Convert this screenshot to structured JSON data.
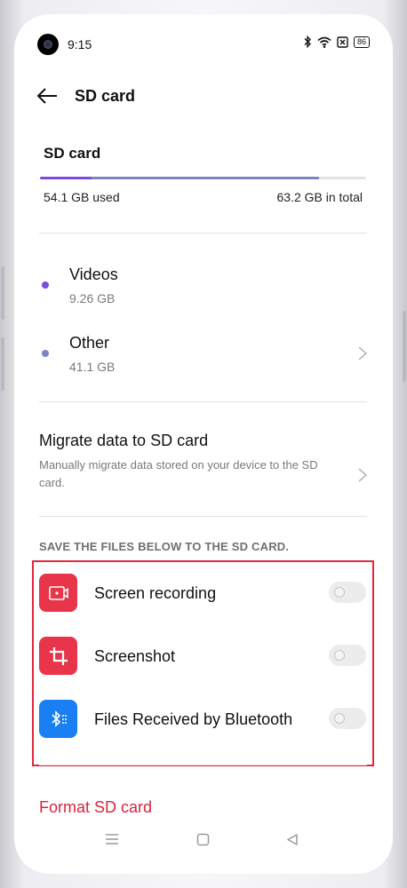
{
  "status_bar": {
    "time": "9:15",
    "battery": "86"
  },
  "header": {
    "title": "SD card"
  },
  "storage": {
    "title": "SD card",
    "used_label": "54.1 GB used",
    "total_label": "63.2 GB in total",
    "used_fraction": 0.856
  },
  "categories": [
    {
      "name": "Videos",
      "size": "9.26 GB",
      "color": "#7b4bdb"
    },
    {
      "name": "Other",
      "size": "41.1 GB",
      "color": "#7a86c2"
    }
  ],
  "migrate": {
    "title": "Migrate data to SD card",
    "description": "Manually migrate data stored on your device to the SD card."
  },
  "save_section": {
    "header": "SAVE THE FILES BELOW TO THE SD CARD.",
    "options": [
      {
        "label": "Screen recording",
        "icon": "screen-recording-icon",
        "color": "#e8354a",
        "enabled": false
      },
      {
        "label": "Screenshot",
        "icon": "crop-icon",
        "color": "#e8354a",
        "enabled": false
      },
      {
        "label": "Files Received by Bluetooth",
        "icon": "bluetooth-icon",
        "color": "#1a7ff2",
        "enabled": false
      }
    ]
  },
  "format": {
    "label": "Format SD card",
    "color": "#d6263d"
  },
  "nav": {
    "items": [
      "menu-icon",
      "home-icon",
      "back-triangle-icon"
    ]
  }
}
